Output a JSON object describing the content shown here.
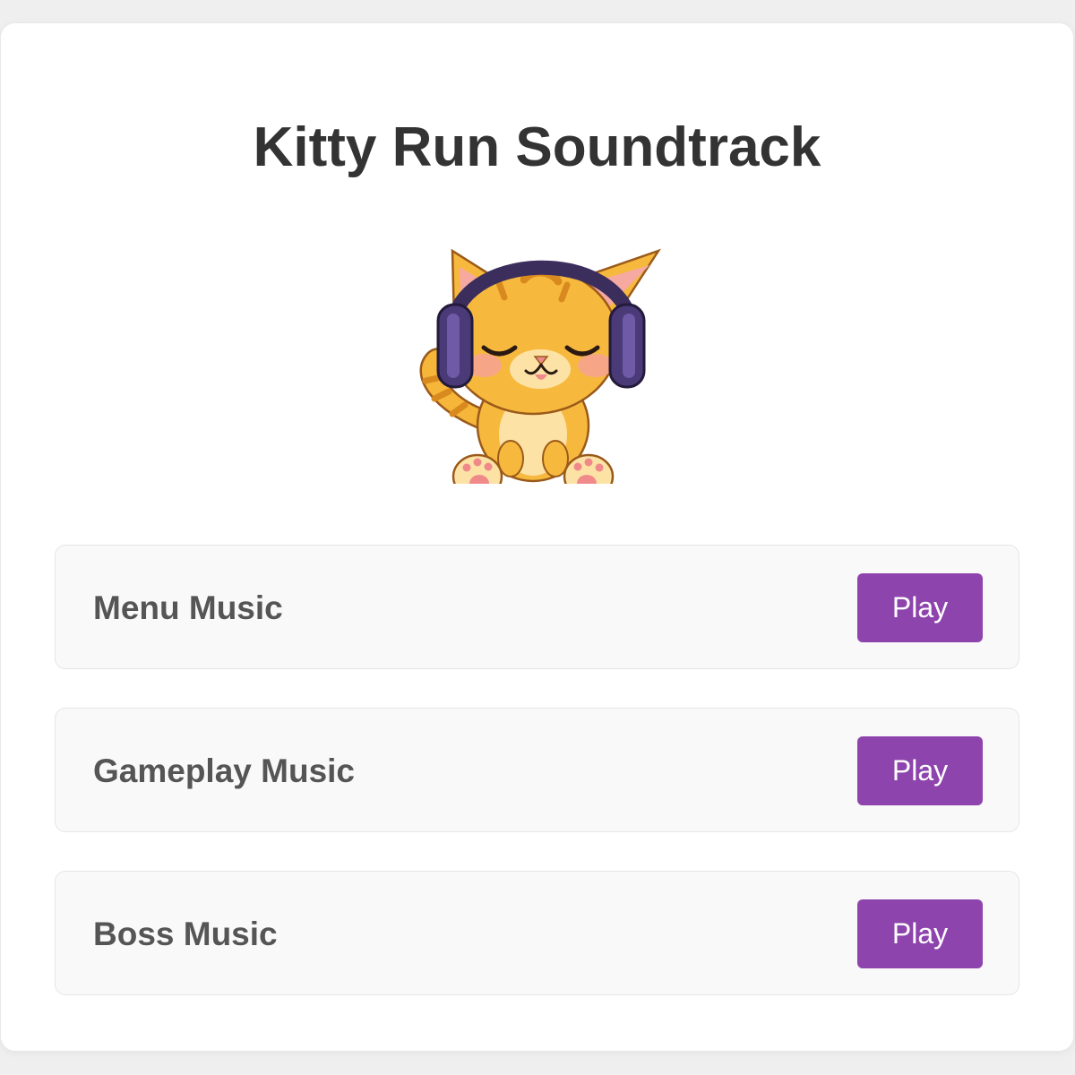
{
  "page": {
    "title": "Kitty Run Soundtrack"
  },
  "mascot": {
    "icon": "cat-with-headphones-icon"
  },
  "tracks": [
    {
      "name": "Menu Music",
      "button_label": "Play"
    },
    {
      "name": "Gameplay Music",
      "button_label": "Play"
    },
    {
      "name": "Boss Music",
      "button_label": "Play"
    }
  ],
  "colors": {
    "accent": "#8e44ad",
    "title": "#333333",
    "track_text": "#555555",
    "track_bg": "#f9f9f9",
    "page_bg": "#efefef"
  }
}
